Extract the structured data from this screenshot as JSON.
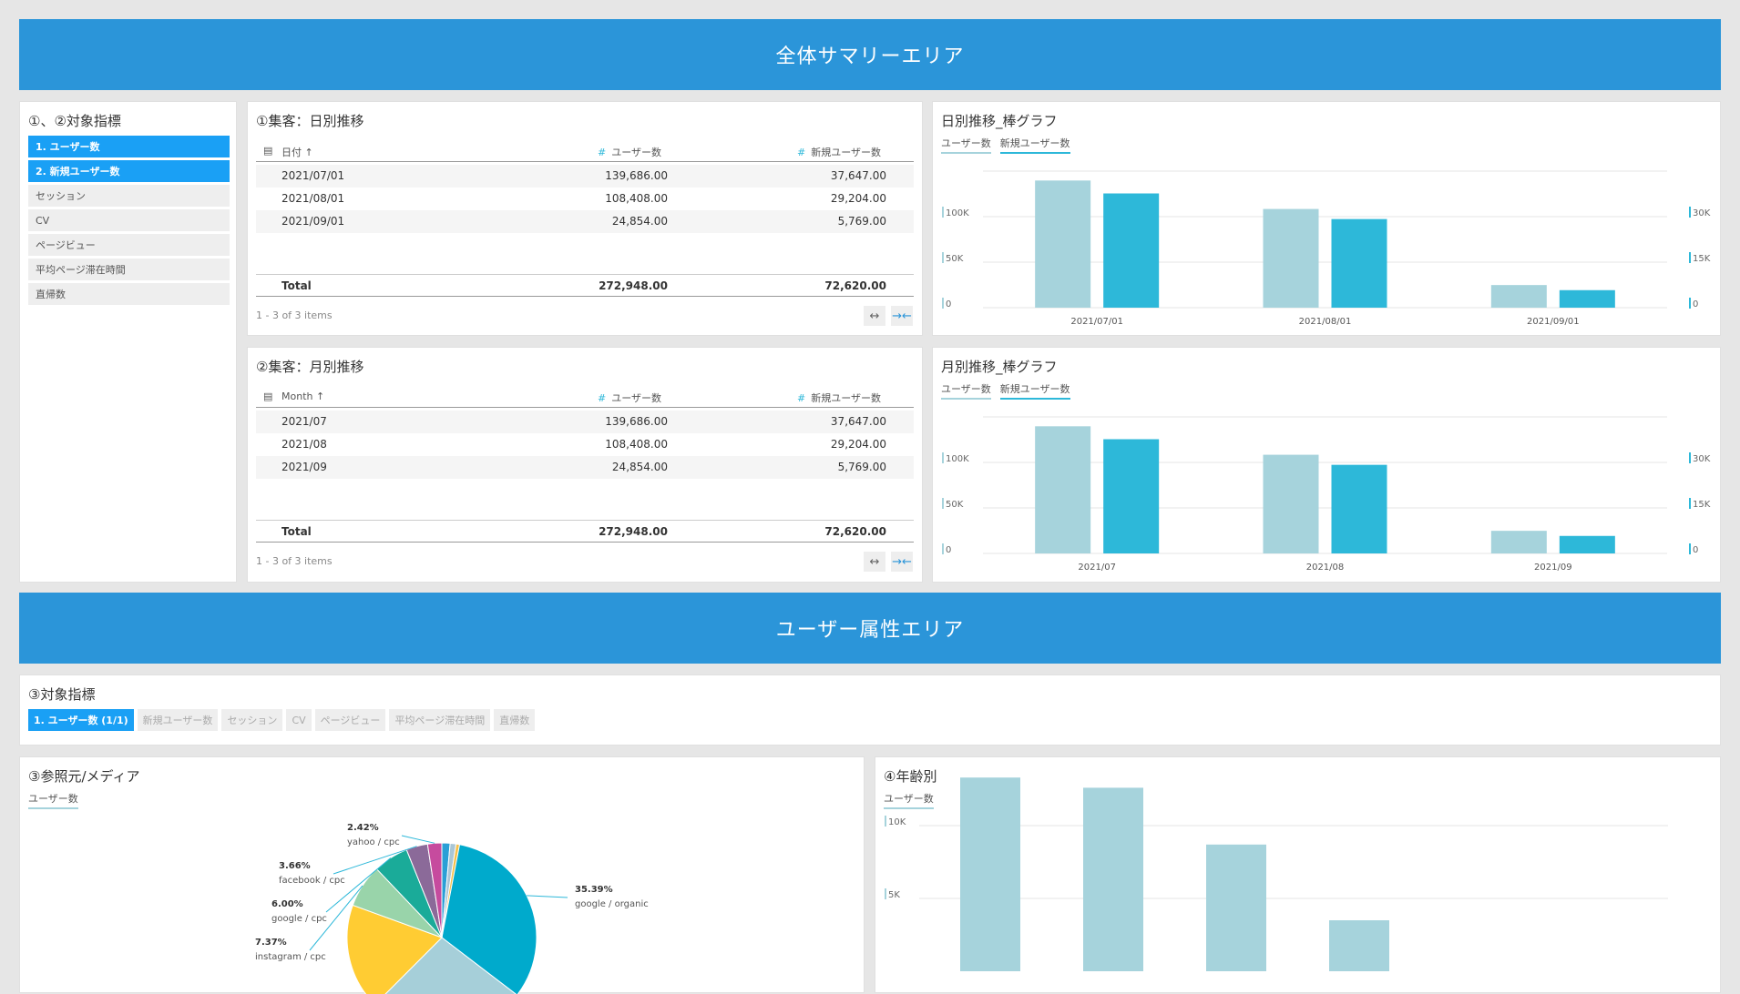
{
  "banners": {
    "summary": "全体サマリーエリア",
    "attributes": "ユーザー属性エリア"
  },
  "metrics_panel": {
    "title": "①、②対象指標",
    "items": [
      "1. ユーザー数",
      "2. 新規ユーザー数",
      "セッション",
      "CV",
      "ページビュー",
      "平均ページ滞在時間",
      "直帰数"
    ]
  },
  "daily_table": {
    "title": "①集客：日別推移",
    "headers": [
      "日付",
      "ユーザー数",
      "新規ユーザー数"
    ],
    "rows": [
      [
        "2021/07/01",
        "139,686.00",
        "37,647.00"
      ],
      [
        "2021/08/01",
        "108,408.00",
        "29,204.00"
      ],
      [
        "2021/09/01",
        "24,854.00",
        "5,769.00"
      ]
    ],
    "total": [
      "Total",
      "272,948.00",
      "72,620.00"
    ],
    "footer": "1 - 3 of 3 items"
  },
  "monthly_table": {
    "title": "②集客：月別推移",
    "headers": [
      "Month",
      "ユーザー数",
      "新規ユーザー数"
    ],
    "rows": [
      [
        "2021/07",
        "139,686.00",
        "37,647.00"
      ],
      [
        "2021/08",
        "108,408.00",
        "29,204.00"
      ],
      [
        "2021/09",
        "24,854.00",
        "5,769.00"
      ]
    ],
    "total": [
      "Total",
      "272,948.00",
      "72,620.00"
    ],
    "footer": "1 - 3 of 3 items"
  },
  "daily_chart": {
    "title": "日別推移_棒グラフ",
    "legend": [
      "ユーザー数",
      "新規ユーザー数"
    ]
  },
  "monthly_chart": {
    "title": "月別推移_棒グラフ",
    "legend": [
      "ユーザー数",
      "新規ユーザー数"
    ]
  },
  "metrics_tabs": {
    "title": "③対象指標",
    "items": [
      "1. ユーザー数 (1/1)",
      "新規ユーザー数",
      "セッション",
      "CV",
      "ページビュー",
      "平均ページ滞在時間",
      "直帰数"
    ]
  },
  "referrer_chart": {
    "title": "③参照元/メディア",
    "legend": [
      "ユーザー数"
    ]
  },
  "age_chart": {
    "title": "④年齢別",
    "legend": [
      "ユーザー数"
    ]
  },
  "colors": {
    "banner": "#2b95d9",
    "active": "#1aa0f5",
    "bar_users": "#a6d3dc",
    "bar_new": "#2db8d9"
  },
  "chart_data": [
    {
      "type": "bar",
      "categories": [
        "2021/07/01",
        "2021/08/01",
        "2021/09/01"
      ],
      "series": [
        {
          "name": "ユーザー数",
          "values": [
            139686,
            108408,
            24854
          ],
          "axis": "left"
        },
        {
          "name": "新規ユーザー数",
          "values": [
            37647,
            29204,
            5769
          ],
          "axis": "right"
        }
      ],
      "y_left_ticks": [
        "0",
        "50K",
        "100K"
      ],
      "y_right_ticks": [
        "0",
        "15K",
        "30K"
      ],
      "ylim_left": [
        0,
        150000
      ],
      "ylim_right": [
        0,
        45000
      ],
      "grid": true
    },
    {
      "type": "bar",
      "categories": [
        "2021/07",
        "2021/08",
        "2021/09"
      ],
      "series": [
        {
          "name": "ユーザー数",
          "values": [
            139686,
            108408,
            24854
          ],
          "axis": "left"
        },
        {
          "name": "新規ユーザー数",
          "values": [
            37647,
            29204,
            5769
          ],
          "axis": "right"
        }
      ],
      "y_left_ticks": [
        "0",
        "50K",
        "100K"
      ],
      "y_right_ticks": [
        "0",
        "15K",
        "30K"
      ],
      "ylim_left": [
        0,
        150000
      ],
      "ylim_right": [
        0,
        45000
      ],
      "grid": true
    },
    {
      "type": "pie",
      "labels": [
        "google / organic",
        "instagram / cpc",
        "google / cpc",
        "facebook / cpc",
        "yahoo / cpc"
      ],
      "percent_labels": [
        "35.39%",
        "7.37%",
        "6.00%",
        "3.66%",
        "2.42%"
      ],
      "values": [
        35.39,
        7.37,
        6.0,
        3.66,
        2.42
      ]
    },
    {
      "type": "bar",
      "series": [
        {
          "name": "ユーザー数",
          "values": [
            13300,
            12600,
            8700,
            3500
          ]
        }
      ],
      "y_ticks": [
        "5K",
        "10K"
      ],
      "grid": true
    }
  ]
}
